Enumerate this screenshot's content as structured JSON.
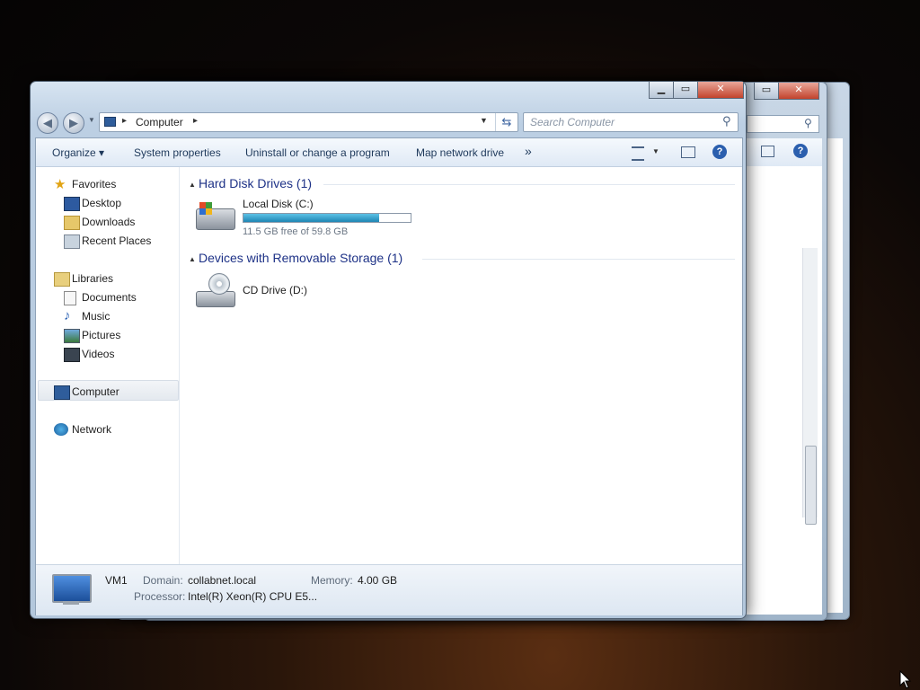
{
  "background_window": {
    "buttons": [
      "▭",
      "✕"
    ]
  },
  "window": {
    "address": {
      "segments": [
        "Computer"
      ],
      "separator": "▸"
    },
    "search": {
      "placeholder": "Search Computer"
    },
    "toolbar": {
      "organize": "Organize ▾",
      "system_properties": "System properties",
      "uninstall": "Uninstall or change a program",
      "map_drive": "Map network drive",
      "more": "»"
    },
    "nav": {
      "favorites": "Favorites",
      "desktop": "Desktop",
      "downloads": "Downloads",
      "recent_places": "Recent Places",
      "libraries": "Libraries",
      "documents": "Documents",
      "music": "Music",
      "pictures": "Pictures",
      "videos": "Videos",
      "computer": "Computer",
      "network": "Network"
    },
    "content": {
      "hdd_group": "Hard Disk Drives (1)",
      "removable_group": "Devices with Removable Storage (1)",
      "local_disk": {
        "name": "Local Disk (C:)",
        "free_text": "11.5 GB free of 59.8 GB",
        "used_fraction": 0.81
      },
      "cd_drive": {
        "name": "CD Drive (D:)"
      }
    },
    "details": {
      "name": "VM1",
      "domain_label": "Domain:",
      "domain_value": "collabnet.local",
      "memory_label": "Memory:",
      "memory_value": "4.00 GB",
      "processor_label": "Processor:",
      "processor_value": "Intel(R) Xeon(R) CPU E5..."
    }
  },
  "colors": {
    "accent": "#1e3287",
    "bar_fill": "#2a9bc9",
    "close_red": "#c2432c"
  }
}
